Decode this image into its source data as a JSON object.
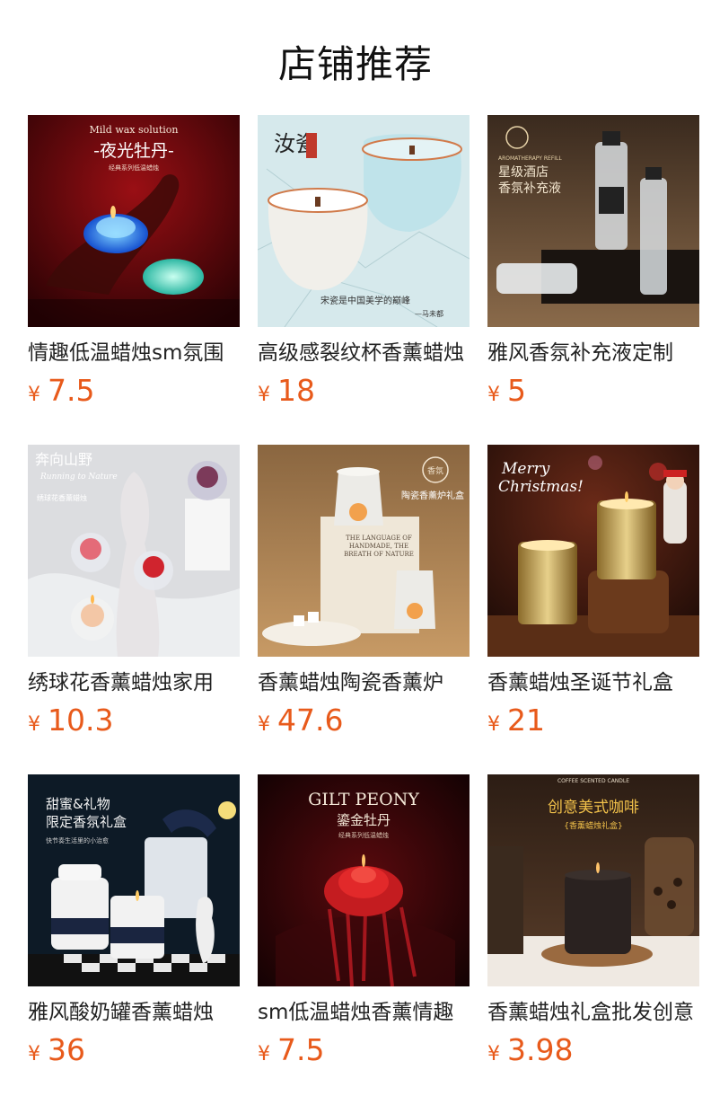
{
  "section": {
    "title": "店铺推荐"
  },
  "currency_symbol": "¥",
  "price_color": "#e85a1b",
  "products": [
    {
      "name": "情趣低温蜡烛sm氛围",
      "price": "7.5",
      "thumb_icon": "peony-candle-image",
      "image_text": {
        "line1": "Mild wax solution",
        "line2": "-夜光牡丹-",
        "line3": "经典系列低温蜡烛"
      }
    },
    {
      "name": "高级感裂纹杯香薰蜡烛",
      "price": "18",
      "thumb_icon": "crackle-cup-candle-image",
      "image_text": {
        "line1": "汝瓷",
        "line2": "宋瓷是中国美学的巅峰",
        "line3": "—马未都"
      }
    },
    {
      "name": "雅风香氛补充液定制",
      "price": "5",
      "thumb_icon": "refill-bottles-image",
      "image_text": {
        "line1": "星级酒店",
        "line2": "香氛补充液",
        "line3": "AROMATHERAPY REFILL"
      }
    },
    {
      "name": "绣球花香薰蜡烛家用",
      "price": "10.3",
      "thumb_icon": "hydrangea-candle-image",
      "image_text": {
        "line1": "奔向山野",
        "line2": "Running to Nature",
        "line3": "绣球花香薰蜡烛"
      }
    },
    {
      "name": "香薰蜡烛陶瓷香薰炉",
      "price": "47.6",
      "thumb_icon": "ceramic-burner-image",
      "image_text": {
        "line1": "陶瓷香薰炉礼盒",
        "line2": "THE LANGUAGE OF HANDMADE, THE BREATH OF NATURE",
        "line3": "香氛"
      }
    },
    {
      "name": "香薰蜡烛圣诞节礼盒",
      "price": "21",
      "thumb_icon": "christmas-candle-image",
      "image_text": {
        "line1": "Merry",
        "line2": "Christmas!",
        "line3": ""
      }
    },
    {
      "name": "雅风酸奶罐香薰蜡烛",
      "price": "36",
      "thumb_icon": "yogurt-jar-candle-image",
      "image_text": {
        "line1": "甜蜜&礼物",
        "line2": "限定香氛礼盒",
        "line3": "快节奏生活里的小治愈"
      }
    },
    {
      "name": "sm低温蜡烛香薰情趣",
      "price": "7.5",
      "thumb_icon": "gilt-peony-candle-image",
      "image_text": {
        "line1": "GILT PEONY",
        "line2": "鎏金牡丹",
        "line3": "经典系列低温蜡烛"
      }
    },
    {
      "name": "香薰蜡烛礼盒批发创意",
      "price": "3.98",
      "thumb_icon": "coffee-candle-image",
      "image_text": {
        "line1": "创意美式咖啡",
        "line2": "{香薰蜡烛礼盒}",
        "line3": "COFFEE    SCENTED    CANDLE"
      }
    }
  ]
}
